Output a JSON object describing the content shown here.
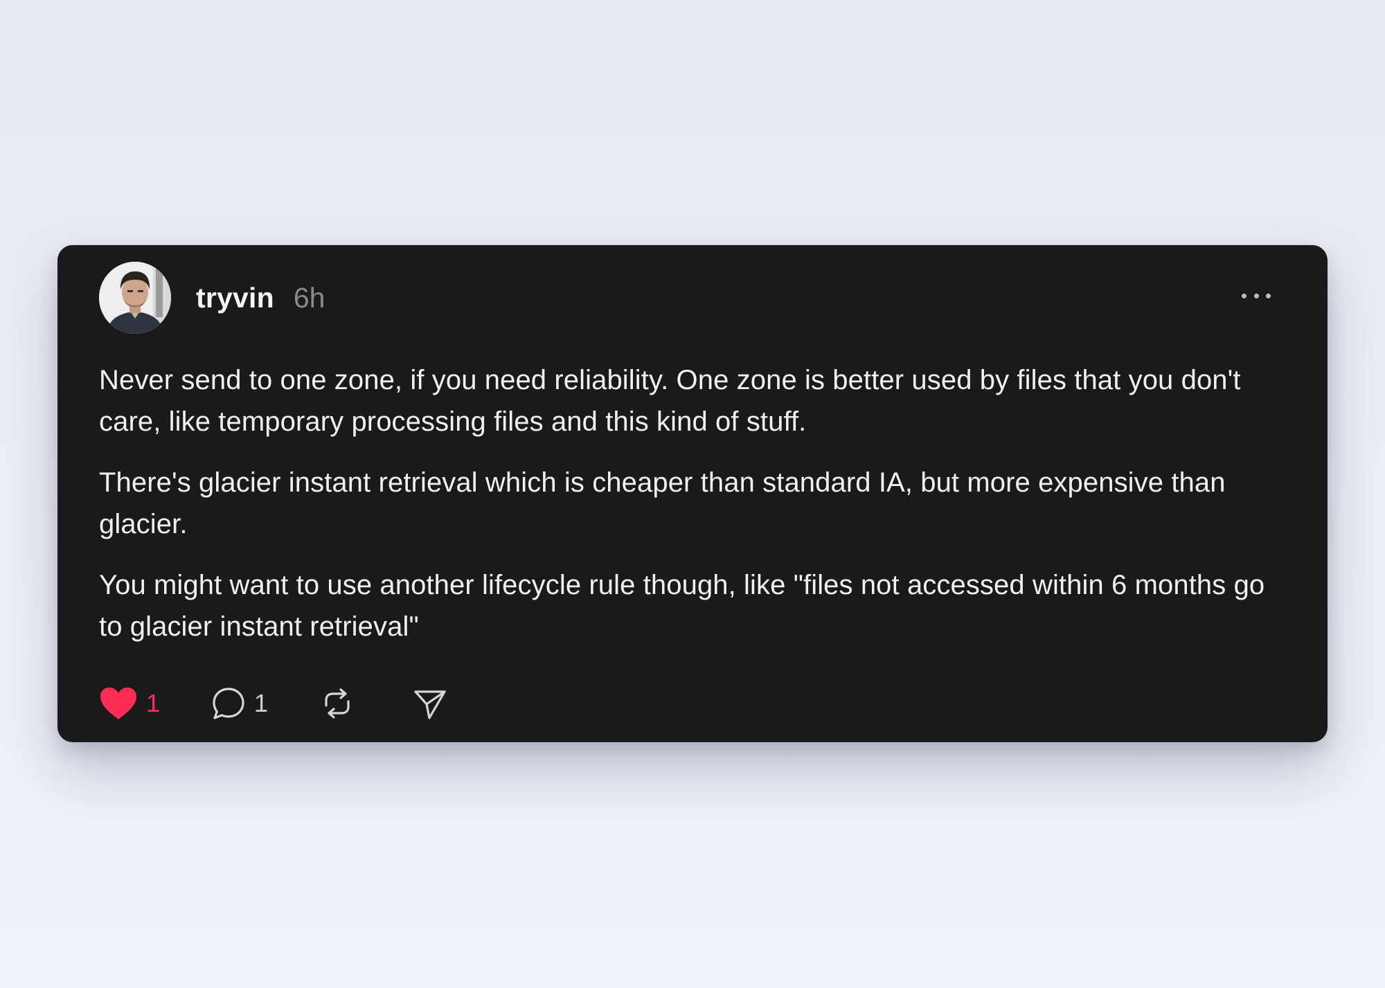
{
  "post": {
    "username": "tryvin",
    "time": "6h",
    "paragraphs": [
      "Never send to one zone, if you need reliability. One zone is better used by files that you don't care, like temporary processing files and this kind of stuff.",
      "There's glacier instant retrieval which is cheaper than standard IA, but more expensive than glacier.",
      "You might want to use another lifecycle rule though, like \"files not accessed within 6 months go to glacier instant retrieval\""
    ],
    "likes": "1",
    "replies": "1"
  },
  "icons": {
    "more": "ellipsis-icon",
    "like": "heart-icon",
    "reply": "speech-bubble-icon",
    "repost": "repost-icon",
    "share": "paper-plane-icon"
  },
  "colors": {
    "card": "#1a1a1b",
    "like_active": "#ff2d55",
    "muted": "#8a8a8d"
  }
}
